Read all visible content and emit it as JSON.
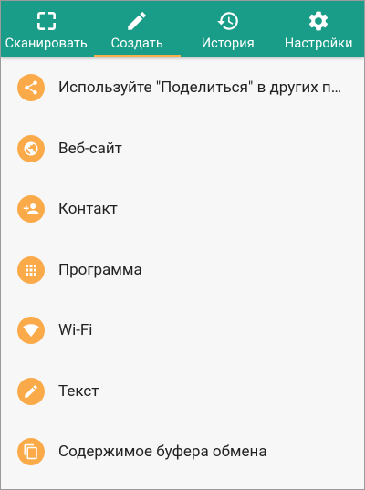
{
  "tabs": [
    {
      "label": "Сканировать",
      "icon": "scan-frame-icon",
      "active": false
    },
    {
      "label": "Создать",
      "icon": "pencil-icon",
      "active": true
    },
    {
      "label": "История",
      "icon": "history-icon",
      "active": false
    },
    {
      "label": "Настройки",
      "icon": "gear-icon",
      "active": false
    }
  ],
  "items": [
    {
      "label": "Используйте \"Поделиться\" в других приложениях",
      "icon": "share-icon"
    },
    {
      "label": "Веб-сайт",
      "icon": "globe-icon"
    },
    {
      "label": "Контакт",
      "icon": "add-contact-icon"
    },
    {
      "label": "Программа",
      "icon": "apps-grid-icon"
    },
    {
      "label": "Wi-Fi",
      "icon": "wifi-icon"
    },
    {
      "label": "Текст",
      "icon": "pencil-icon"
    },
    {
      "label": "Содержимое буфера обмена",
      "icon": "clipboard-copy-icon"
    }
  ],
  "colors": {
    "toolbar": "#1a9d88",
    "tab_indicator": "#f7b04a",
    "icon_circle": "#fbaa4a",
    "background": "#f7f7f7"
  }
}
